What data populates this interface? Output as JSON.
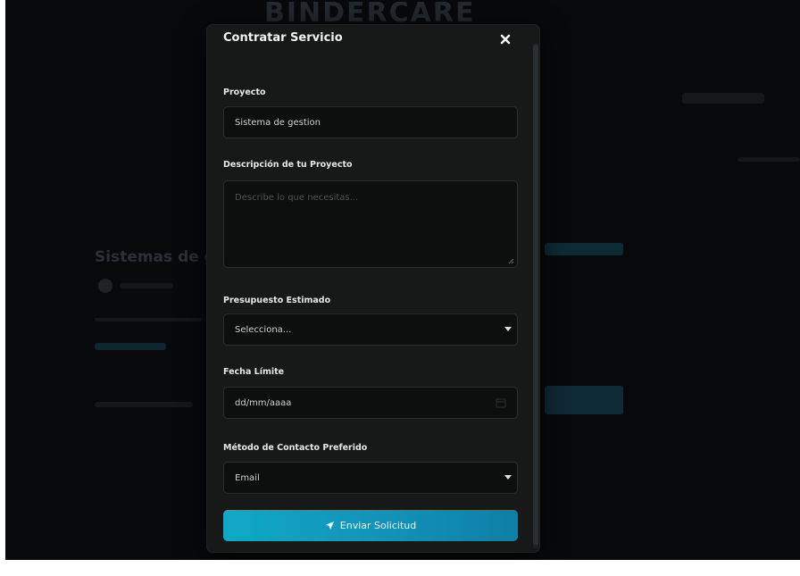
{
  "background": {
    "logo_text": "BINDERCARE",
    "section_title": "Sistemas de g"
  },
  "modal": {
    "title": "Contratar Servicio",
    "close_icon": "close-icon",
    "fields": {
      "project": {
        "label": "Proyecto",
        "value": "Sistema de gestion"
      },
      "description": {
        "label": "Descripción de tu Proyecto",
        "placeholder": "Describe lo que necesitas..."
      },
      "budget": {
        "label": "Presupuesto Estimado",
        "selected": "Selecciona..."
      },
      "deadline": {
        "label": "Fecha Límite",
        "placeholder": "dd/mm/aaaa"
      },
      "contact": {
        "label": "Método de Contacto Preferido",
        "selected": "Email"
      }
    },
    "submit": {
      "label": "Enviar Solicitud",
      "icon": "send-icon"
    }
  },
  "colors": {
    "accent": "#10a9c7",
    "modal_bg": "#171818",
    "field_bg": "#0d0e0e"
  }
}
